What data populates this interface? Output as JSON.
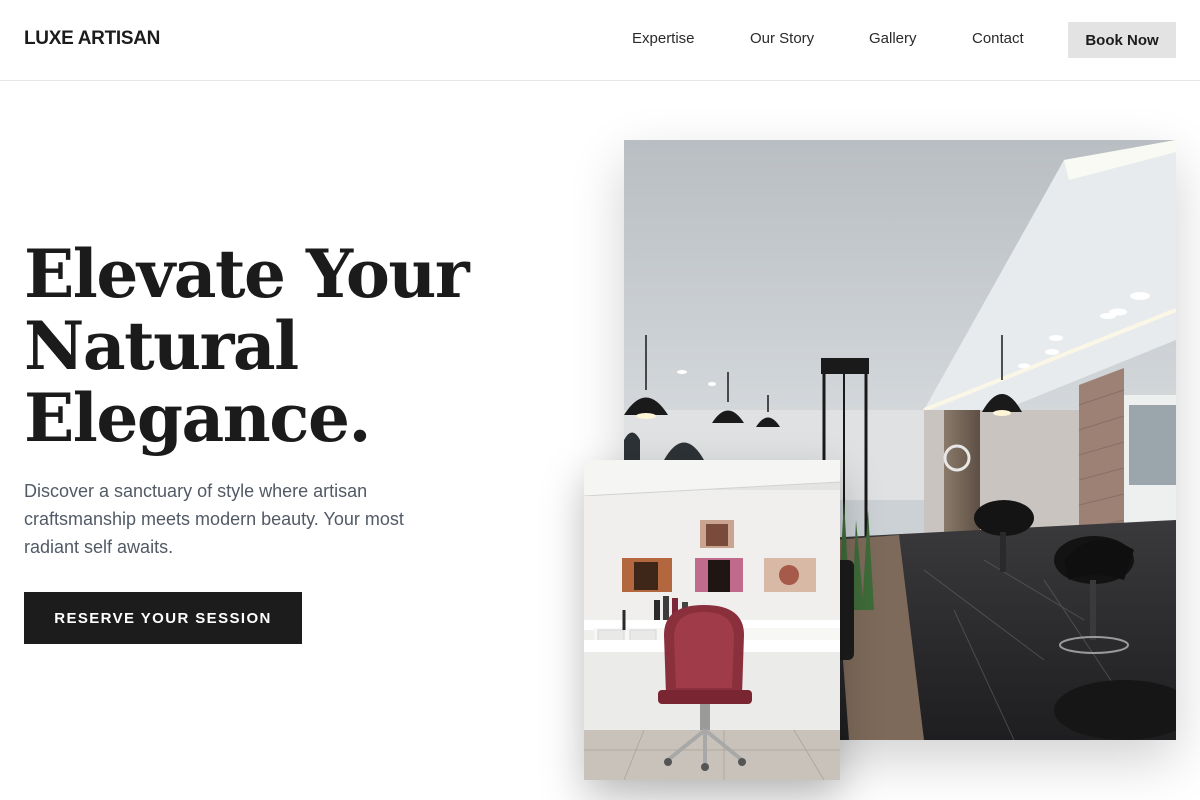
{
  "header": {
    "brand": "LUXE ARTISAN",
    "nav": [
      "Expertise",
      "Our Story",
      "Gallery",
      "Contact"
    ],
    "cta": "Book Now"
  },
  "hero": {
    "headline_lines": [
      "Elevate Your",
      "Natural",
      "Elegance."
    ],
    "description": "Discover a sanctuary of style where artisan craftsmanship meets modern beauty. Your most radiant self awaits.",
    "cta": "RESERVE YOUR SESSION"
  },
  "images": {
    "main": "salon-interior-photo",
    "secondary": "styling-station-photo"
  },
  "colors": {
    "primary_dark": "#1c1c1c",
    "secondary_button": "#e3e3e3",
    "body_text": "#525a66"
  }
}
